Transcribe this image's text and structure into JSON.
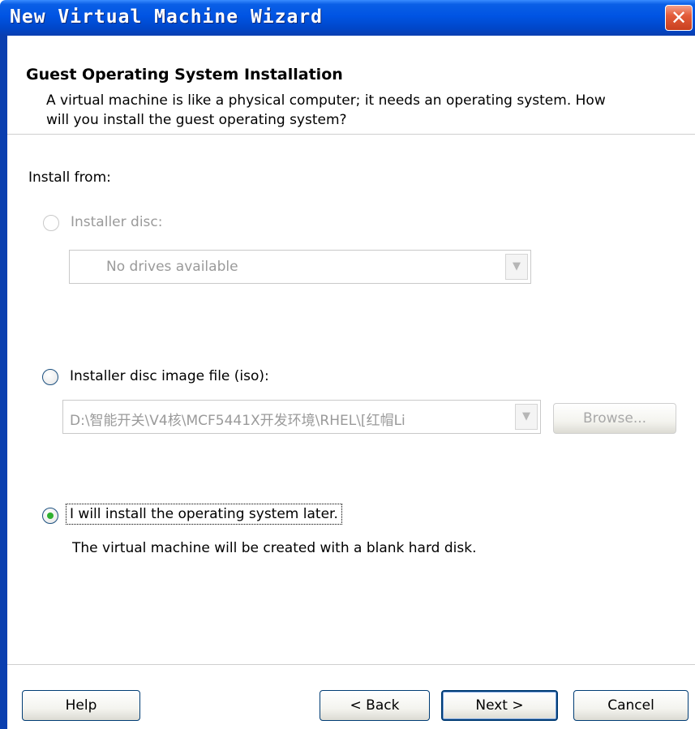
{
  "window": {
    "title": "New Virtual Machine Wizard",
    "close_glyph": "✕"
  },
  "header": {
    "title": "Guest Operating System Installation",
    "description": "A virtual machine is like a physical computer; it needs an operating system. How will you install the guest operating system?"
  },
  "install_from": {
    "label": "Install from:",
    "options": [
      {
        "label": "Installer disc:",
        "enabled": false,
        "selected": false,
        "combo_value": "No drives available"
      },
      {
        "label": "Installer disc image file (iso):",
        "enabled": true,
        "selected": false,
        "combo_value": "D:\\智能开关\\V4核\\MCF5441X开发环境\\RHEL\\[红帽Li",
        "browse_label": "Browse..."
      },
      {
        "label": "I will install the operating system later.",
        "enabled": true,
        "selected": true,
        "description": "The virtual machine will be created with a blank hard disk."
      }
    ]
  },
  "footer": {
    "help_label": "Help",
    "back_label": "< Back",
    "next_label": "Next >",
    "cancel_label": "Cancel"
  },
  "icons": {
    "dropdown_arrow": "▼"
  },
  "colors": {
    "titlebar": "#0054e3",
    "close_button": "#e35c3a",
    "disabled_text": "#9a9a9a",
    "radio_selected": "#2fb02f"
  }
}
